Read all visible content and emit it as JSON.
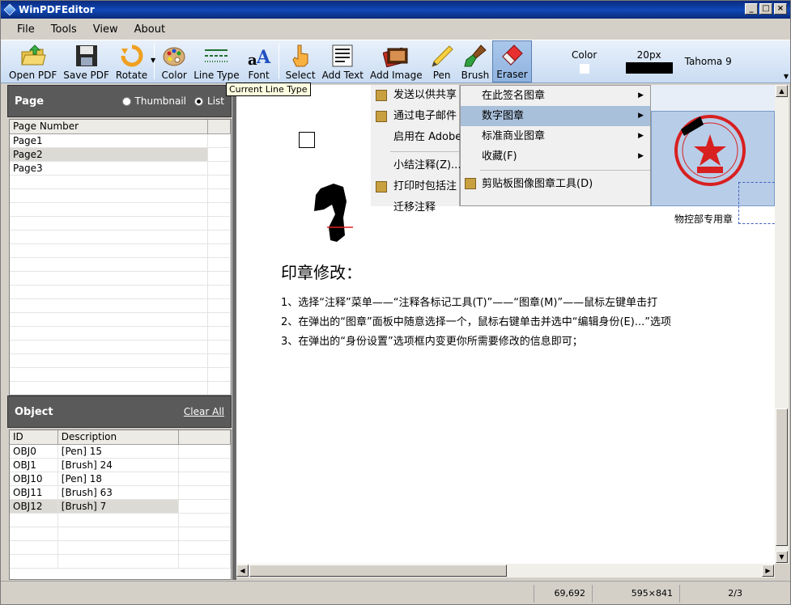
{
  "window": {
    "title": "WinPDFEditor"
  },
  "menu": [
    "File",
    "Tools",
    "View",
    "About"
  ],
  "toolbar": {
    "open": "Open PDF",
    "save": "Save PDF",
    "rotate": "Rotate",
    "color": "Color",
    "line_type": "Line Type",
    "font": "Font",
    "select": "Select",
    "add_text": "Add Text",
    "add_image": "Add Image",
    "pen": "Pen",
    "brush": "Brush",
    "eraser": "Eraser",
    "color_label": "Color",
    "size_label": "20px",
    "font_value": "Tahoma 9",
    "tooltip": "Current Line Type",
    "active_tool": "Eraser"
  },
  "page_panel": {
    "title": "Page",
    "thumbnail_label": "Thumbnail",
    "list_label": "List",
    "view_mode": "List",
    "column": "Page Number",
    "rows": [
      "Page1",
      "Page2",
      "Page3"
    ],
    "selected_index": 1
  },
  "object_panel": {
    "title": "Object",
    "clear_all": "Clear All",
    "columns": [
      "ID",
      "Description"
    ],
    "rows": [
      {
        "id": "OBJ0",
        "desc": "[Pen] 15"
      },
      {
        "id": "OBJ1",
        "desc": "[Brush] 24"
      },
      {
        "id": "OBJ10",
        "desc": "[Pen] 18"
      },
      {
        "id": "OBJ11",
        "desc": "[Brush] 63"
      },
      {
        "id": "OBJ12",
        "desc": "[Brush] 7"
      }
    ],
    "selected_index": 4
  },
  "document": {
    "context_menu": [
      "发送以供共享",
      "通过电子邮件",
      "启用在 Adobe",
      "小结注释(Z)...",
      "打印时包括注",
      "迁移注释"
    ],
    "submenu": [
      "在此签名图章",
      "数字图章",
      "标准商业图章",
      "收藏(F)",
      "剪贴板图像图章工具(D)"
    ],
    "submenu_highlight": 1,
    "stamp_caption": "物控部专用章",
    "heading": "印章修改：",
    "lines": [
      "1、选择“注释”菜单——“注释各标记工具(T)”——“图章(M)”——鼠标左键单击打",
      "2、在弹出的“图章”面板中随意选择一个，鼠标右键单击并选中“编辑身份(E)...”选项",
      "3、在弹出的“身份设置”选项框内变更你所需要修改的信息即可；"
    ]
  },
  "status": {
    "coords": "69,692",
    "page_size": "595×841",
    "page": "2/3"
  },
  "colors": {
    "title_bar": "#0a2a7a",
    "toolbar": "#c9dcf3",
    "panel_head": "#5a5a5a",
    "highlight": "#a9c0db"
  }
}
